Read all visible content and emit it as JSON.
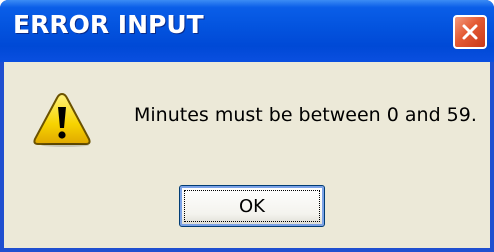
{
  "window": {
    "title": "ERROR INPUT",
    "close_icon": "close-icon"
  },
  "message": {
    "icon": "warning-icon",
    "text": "Minutes must be between 0 and 59."
  },
  "buttons": {
    "ok_label": "OK"
  },
  "colors": {
    "titlebar": "#0353de",
    "client_background": "#ece9d8",
    "close_button": "#e45a33",
    "warning_yellow": "#f7d300"
  }
}
